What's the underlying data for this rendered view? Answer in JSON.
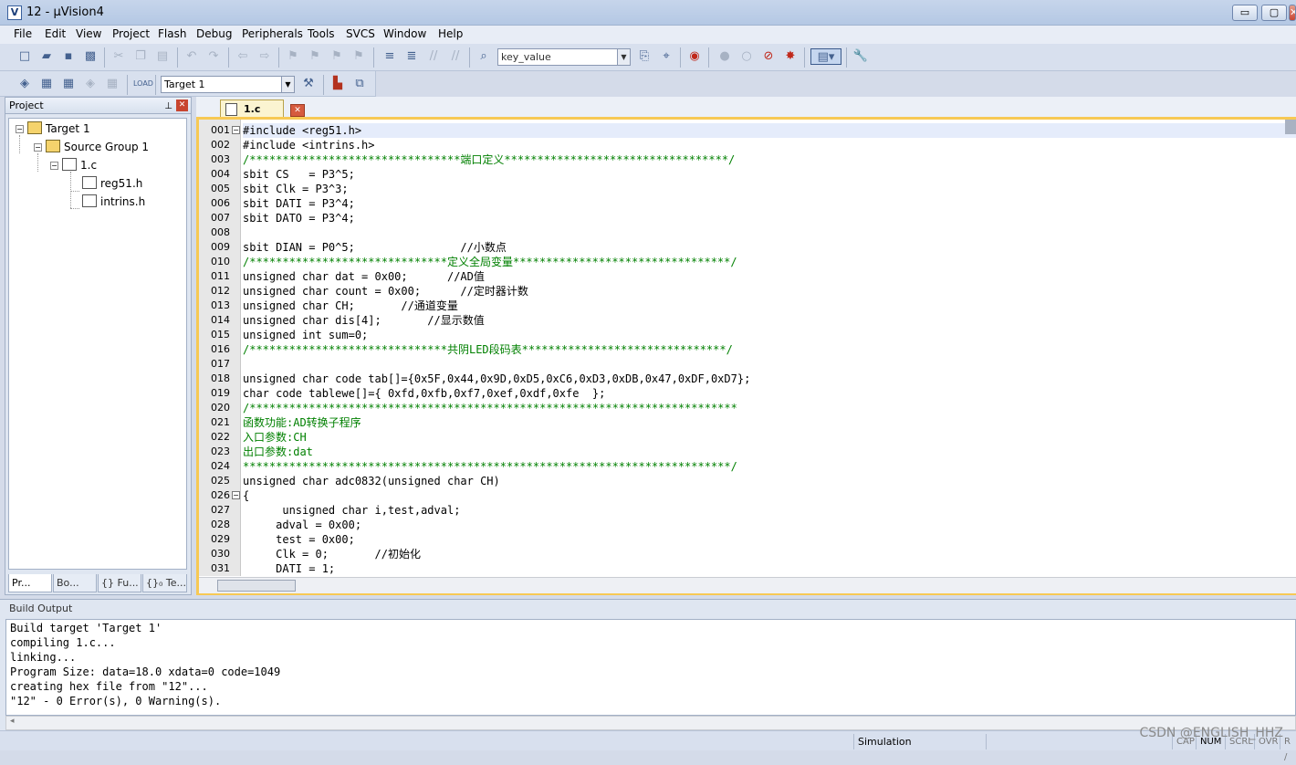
{
  "window": {
    "title": "12  - µVision4",
    "icon": "uvision-icon",
    "min_label": "▭",
    "max_label": "▢",
    "close_label": "✕"
  },
  "menu": [
    "File",
    "Edit",
    "View",
    "Project",
    "Flash",
    "Debug",
    "Peripherals",
    "Tools",
    "SVCS",
    "Window",
    "Help"
  ],
  "toolbar": {
    "find_value": "key_value",
    "target_value": "Target 1"
  },
  "project_panel": {
    "title": "Project",
    "tree": {
      "target": "Target 1",
      "group": "Source Group 1",
      "file": "1.c",
      "headers": [
        "reg51.h",
        "intrins.h"
      ]
    },
    "tabs": [
      "Pr...",
      "Bo...",
      "{} Fu...",
      "{}₀ Te..."
    ]
  },
  "editor": {
    "tab": "1.c",
    "line_numbers": [
      "001",
      "002",
      "003",
      "004",
      "005",
      "006",
      "007",
      "008",
      "009",
      "010",
      "011",
      "012",
      "013",
      "014",
      "015",
      "016",
      "017",
      "018",
      "019",
      "020",
      "021",
      "022",
      "023",
      "024",
      "025",
      "026",
      "027",
      "028",
      "029",
      "030",
      "031"
    ],
    "lines": [
      "#include <reg51.h>",
      "#include <intrins.h>",
      "/********************************端口定义**********************************/",
      "sbit CS   = P3^5;",
      "sbit Clk = P3^3;",
      "sbit DATI = P3^4;",
      "sbit DATO = P3^4;",
      "",
      "sbit DIAN = P0^5;                //小数点",
      "/******************************定义全局变量*********************************/",
      "unsigned char dat = 0x00;      //AD值",
      "unsigned char count = 0x00;      //定时器计数",
      "unsigned char CH;       //通道变量",
      "unsigned char dis[4];       //显示数值",
      "unsigned int sum=0;",
      "/******************************共阴LED段码表*******************************/",
      "",
      "unsigned char code tab[]={0x5F,0x44,0x9D,0xD5,0xC6,0xD3,0xDB,0x47,0xDF,0xD7};",
      "char code tablewe[]={ 0xfd,0xfb,0xf7,0xef,0xdf,0xfe  };",
      "/**************************************************************************",
      "函数功能:AD转换子程序",
      "入口参数:CH",
      "出口参数:dat",
      "**************************************************************************/",
      "unsigned char adc0832(unsigned char CH)",
      "{",
      "      unsigned char i,test,adval;",
      "     adval = 0x00;",
      "     test = 0x00;",
      "     Clk = 0;       //初始化",
      "     DATI = 1;"
    ]
  },
  "build_output": {
    "title": "Build Output",
    "lines": [
      "Build target 'Target 1'",
      "compiling 1.c...",
      "linking...",
      "Program Size: data=18.0 xdata=0 code=1049",
      "creating hex file from \"12\"...",
      "\"12\" - 0 Error(s), 0 Warning(s)."
    ]
  },
  "status": {
    "mode": "Simulation",
    "cap": "CAP",
    "num": "NUM",
    "scrl": "SCRL",
    "ovr": "OVR",
    "rw": "R /"
  },
  "watermark": "CSDN @ENGLISH_HHZ"
}
